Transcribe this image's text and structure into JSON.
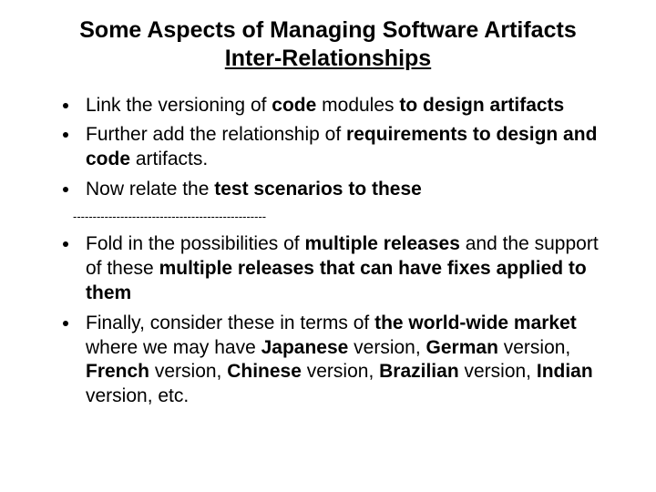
{
  "title_line1": "Some Aspects of Managing Software Artifacts",
  "title_line2": "Inter-Relationships",
  "bullets_top": [
    {
      "parts": [
        {
          "t": "Link the versioning of ",
          "b": false
        },
        {
          "t": "code",
          "b": true
        },
        {
          "t": " modules ",
          "b": false
        },
        {
          "t": "to design artifacts",
          "b": true
        }
      ]
    },
    {
      "parts": [
        {
          "t": "Further add the relationship of ",
          "b": false
        },
        {
          "t": "requirements to design and code",
          "b": true
        },
        {
          "t": " artifacts.",
          "b": false
        }
      ]
    },
    {
      "parts": [
        {
          "t": "Now relate the ",
          "b": false
        },
        {
          "t": "test scenarios to these",
          "b": true
        }
      ]
    }
  ],
  "divider": "-------------------------------------------------",
  "bullets_bottom": [
    {
      "parts": [
        {
          "t": "Fold in the possibilities of ",
          "b": false
        },
        {
          "t": "multiple releases",
          "b": true
        },
        {
          "t": " and the support of these ",
          "b": false
        },
        {
          "t": "multiple releases that can have fixes applied to them",
          "b": true
        }
      ]
    },
    {
      "parts": [
        {
          "t": "Finally, consider these in terms of ",
          "b": false
        },
        {
          "t": "the world-wide market",
          "b": true
        },
        {
          "t": " where we may have ",
          "b": false
        },
        {
          "t": "Japanese",
          "b": true
        },
        {
          "t": " version, ",
          "b": false
        },
        {
          "t": "German",
          "b": true
        },
        {
          "t": " version, ",
          "b": false
        },
        {
          "t": "French",
          "b": true
        },
        {
          "t": " version, ",
          "b": false
        },
        {
          "t": "Chinese",
          "b": true
        },
        {
          "t": " version, ",
          "b": false
        },
        {
          "t": "Brazilian",
          "b": true
        },
        {
          "t": " version, ",
          "b": false
        },
        {
          "t": "Indian",
          "b": true
        },
        {
          "t": " version, etc.",
          "b": false
        }
      ]
    }
  ]
}
